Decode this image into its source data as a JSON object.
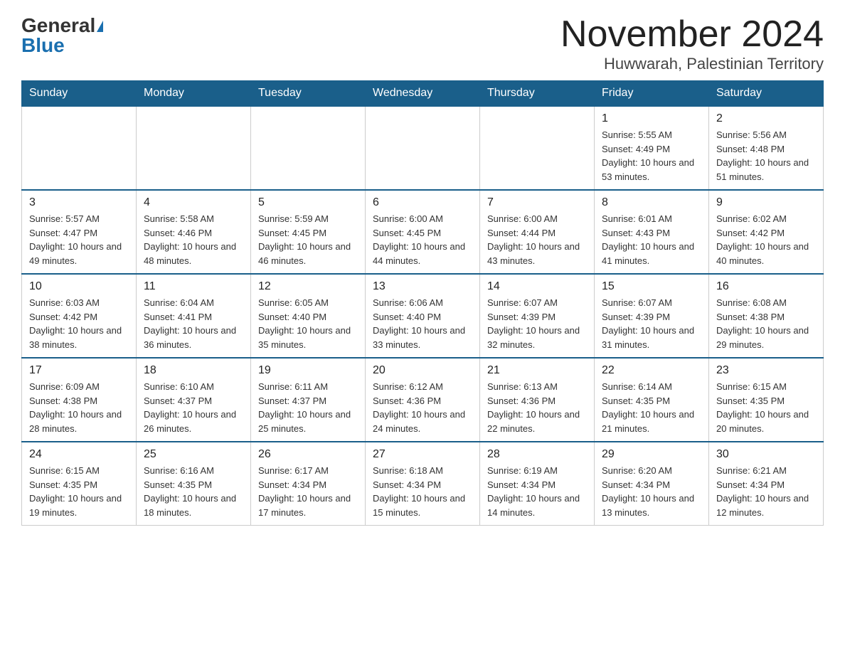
{
  "logo": {
    "general": "General",
    "blue": "Blue"
  },
  "title": "November 2024",
  "subtitle": "Huwwarah, Palestinian Territory",
  "days_of_week": [
    "Sunday",
    "Monday",
    "Tuesday",
    "Wednesday",
    "Thursday",
    "Friday",
    "Saturday"
  ],
  "weeks": [
    [
      {
        "day": "",
        "info": ""
      },
      {
        "day": "",
        "info": ""
      },
      {
        "day": "",
        "info": ""
      },
      {
        "day": "",
        "info": ""
      },
      {
        "day": "",
        "info": ""
      },
      {
        "day": "1",
        "info": "Sunrise: 5:55 AM\nSunset: 4:49 PM\nDaylight: 10 hours and 53 minutes."
      },
      {
        "day": "2",
        "info": "Sunrise: 5:56 AM\nSunset: 4:48 PM\nDaylight: 10 hours and 51 minutes."
      }
    ],
    [
      {
        "day": "3",
        "info": "Sunrise: 5:57 AM\nSunset: 4:47 PM\nDaylight: 10 hours and 49 minutes."
      },
      {
        "day": "4",
        "info": "Sunrise: 5:58 AM\nSunset: 4:46 PM\nDaylight: 10 hours and 48 minutes."
      },
      {
        "day": "5",
        "info": "Sunrise: 5:59 AM\nSunset: 4:45 PM\nDaylight: 10 hours and 46 minutes."
      },
      {
        "day": "6",
        "info": "Sunrise: 6:00 AM\nSunset: 4:45 PM\nDaylight: 10 hours and 44 minutes."
      },
      {
        "day": "7",
        "info": "Sunrise: 6:00 AM\nSunset: 4:44 PM\nDaylight: 10 hours and 43 minutes."
      },
      {
        "day": "8",
        "info": "Sunrise: 6:01 AM\nSunset: 4:43 PM\nDaylight: 10 hours and 41 minutes."
      },
      {
        "day": "9",
        "info": "Sunrise: 6:02 AM\nSunset: 4:42 PM\nDaylight: 10 hours and 40 minutes."
      }
    ],
    [
      {
        "day": "10",
        "info": "Sunrise: 6:03 AM\nSunset: 4:42 PM\nDaylight: 10 hours and 38 minutes."
      },
      {
        "day": "11",
        "info": "Sunrise: 6:04 AM\nSunset: 4:41 PM\nDaylight: 10 hours and 36 minutes."
      },
      {
        "day": "12",
        "info": "Sunrise: 6:05 AM\nSunset: 4:40 PM\nDaylight: 10 hours and 35 minutes."
      },
      {
        "day": "13",
        "info": "Sunrise: 6:06 AM\nSunset: 4:40 PM\nDaylight: 10 hours and 33 minutes."
      },
      {
        "day": "14",
        "info": "Sunrise: 6:07 AM\nSunset: 4:39 PM\nDaylight: 10 hours and 32 minutes."
      },
      {
        "day": "15",
        "info": "Sunrise: 6:07 AM\nSunset: 4:39 PM\nDaylight: 10 hours and 31 minutes."
      },
      {
        "day": "16",
        "info": "Sunrise: 6:08 AM\nSunset: 4:38 PM\nDaylight: 10 hours and 29 minutes."
      }
    ],
    [
      {
        "day": "17",
        "info": "Sunrise: 6:09 AM\nSunset: 4:38 PM\nDaylight: 10 hours and 28 minutes."
      },
      {
        "day": "18",
        "info": "Sunrise: 6:10 AM\nSunset: 4:37 PM\nDaylight: 10 hours and 26 minutes."
      },
      {
        "day": "19",
        "info": "Sunrise: 6:11 AM\nSunset: 4:37 PM\nDaylight: 10 hours and 25 minutes."
      },
      {
        "day": "20",
        "info": "Sunrise: 6:12 AM\nSunset: 4:36 PM\nDaylight: 10 hours and 24 minutes."
      },
      {
        "day": "21",
        "info": "Sunrise: 6:13 AM\nSunset: 4:36 PM\nDaylight: 10 hours and 22 minutes."
      },
      {
        "day": "22",
        "info": "Sunrise: 6:14 AM\nSunset: 4:35 PM\nDaylight: 10 hours and 21 minutes."
      },
      {
        "day": "23",
        "info": "Sunrise: 6:15 AM\nSunset: 4:35 PM\nDaylight: 10 hours and 20 minutes."
      }
    ],
    [
      {
        "day": "24",
        "info": "Sunrise: 6:15 AM\nSunset: 4:35 PM\nDaylight: 10 hours and 19 minutes."
      },
      {
        "day": "25",
        "info": "Sunrise: 6:16 AM\nSunset: 4:35 PM\nDaylight: 10 hours and 18 minutes."
      },
      {
        "day": "26",
        "info": "Sunrise: 6:17 AM\nSunset: 4:34 PM\nDaylight: 10 hours and 17 minutes."
      },
      {
        "day": "27",
        "info": "Sunrise: 6:18 AM\nSunset: 4:34 PM\nDaylight: 10 hours and 15 minutes."
      },
      {
        "day": "28",
        "info": "Sunrise: 6:19 AM\nSunset: 4:34 PM\nDaylight: 10 hours and 14 minutes."
      },
      {
        "day": "29",
        "info": "Sunrise: 6:20 AM\nSunset: 4:34 PM\nDaylight: 10 hours and 13 minutes."
      },
      {
        "day": "30",
        "info": "Sunrise: 6:21 AM\nSunset: 4:34 PM\nDaylight: 10 hours and 12 minutes."
      }
    ]
  ]
}
